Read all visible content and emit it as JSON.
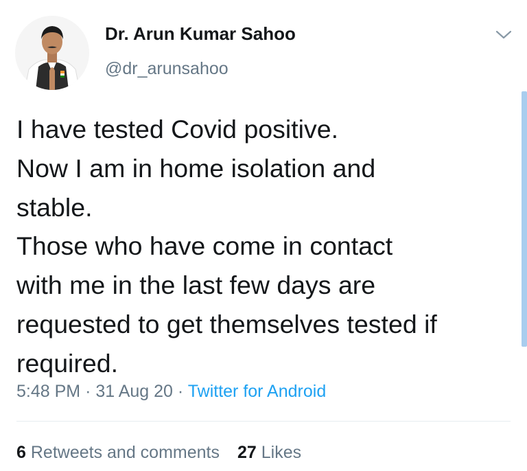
{
  "author": {
    "display_name": "Dr. Arun Kumar Sahoo",
    "handle": "@dr_arunsahoo",
    "avatar_icon": "profile-photo-icon"
  },
  "menu": {
    "icon": "chevron-down-icon"
  },
  "tweet": {
    "lines": [
      "I have tested Covid positive.",
      "Now I am in home isolation and",
      "stable.",
      "Those who have come in contact",
      "with me in the last few days are",
      "requested to get themselves tested if",
      "required."
    ]
  },
  "meta": {
    "time": "5:48 PM",
    "separator": "·",
    "date": "31 Aug 20",
    "source": "Twitter for Android"
  },
  "stats": {
    "retweets_count": "6",
    "retweets_label": "Retweets and comments",
    "likes_count": "27",
    "likes_label": "Likes"
  },
  "colors": {
    "text": "#14171a",
    "secondary": "#657786",
    "accent": "#1da1f2",
    "scrollbar": "#a9cdee",
    "divider": "#e6ecf0"
  }
}
